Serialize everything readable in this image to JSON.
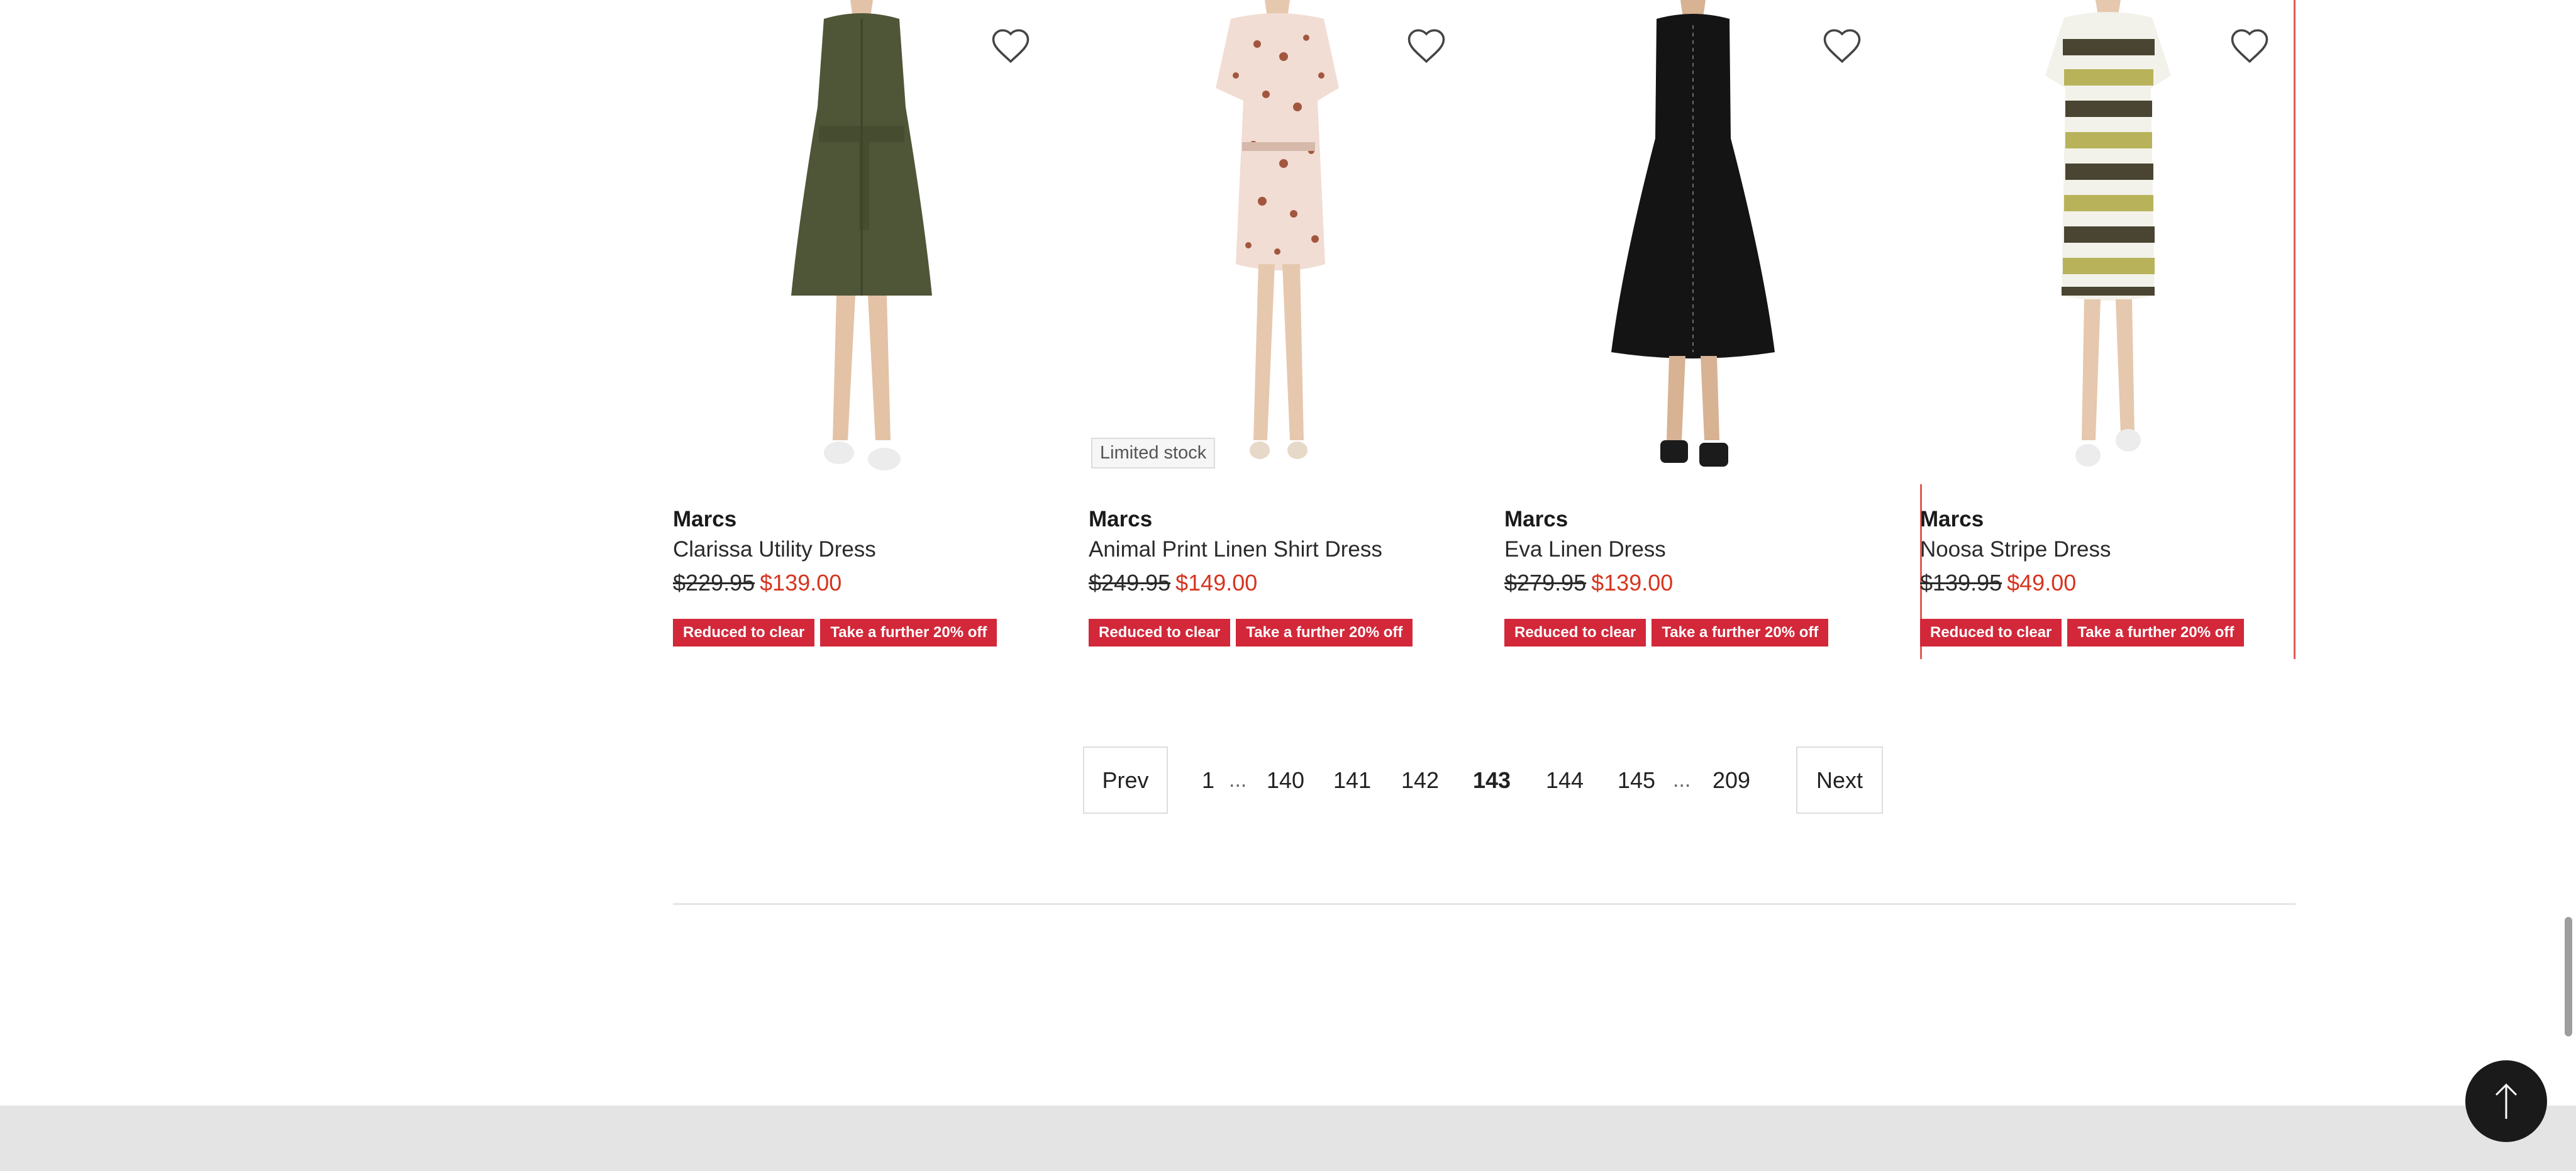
{
  "products": [
    {
      "brand": "Marcs",
      "name": "Clarissa Utility Dress",
      "was_price": "$229.95",
      "now_price": "$139.00",
      "badges": [
        "Reduced to clear",
        "Take a further 20% off"
      ],
      "stock_tag": null,
      "wishlist_icon": "heart-outline-icon",
      "dress_color": "#4f5638"
    },
    {
      "brand": "Marcs",
      "name": "Animal Print Linen Shirt Dress",
      "was_price": "$249.95",
      "now_price": "$149.00",
      "badges": [
        "Reduced to clear",
        "Take a further 20% off"
      ],
      "stock_tag": "Limited stock",
      "wishlist_icon": "heart-outline-icon",
      "dress_color": "#f1ddd3"
    },
    {
      "brand": "Marcs",
      "name": "Eva Linen Dress",
      "was_price": "$279.95",
      "now_price": "$139.00",
      "badges": [
        "Reduced to clear",
        "Take a further 20% off"
      ],
      "stock_tag": null,
      "wishlist_icon": "heart-outline-icon",
      "dress_color": "#141414"
    },
    {
      "brand": "Marcs",
      "name": "Noosa Stripe Dress",
      "was_price": "$139.95",
      "now_price": "$49.00",
      "badges": [
        "Reduced to clear",
        "Take a further 20% off"
      ],
      "stock_tag": null,
      "wishlist_icon": "heart-outline-icon",
      "dress_color": "#f2f2ea"
    }
  ],
  "pagination": {
    "prev_label": "Prev",
    "next_label": "Next",
    "pages": [
      "1",
      "140",
      "141",
      "142",
      "143",
      "144",
      "145",
      "209"
    ],
    "ellipsis": "...",
    "current_page": "143"
  },
  "back_to_top_icon": "arrow-up-icon",
  "colors": {
    "sale_price": "#d6341f",
    "badge_bg": "#d2283a",
    "selected_card_outline": "#e25c52",
    "footer_bg": "#e4e4e4",
    "back_to_top_bg": "#1a1a1a"
  }
}
